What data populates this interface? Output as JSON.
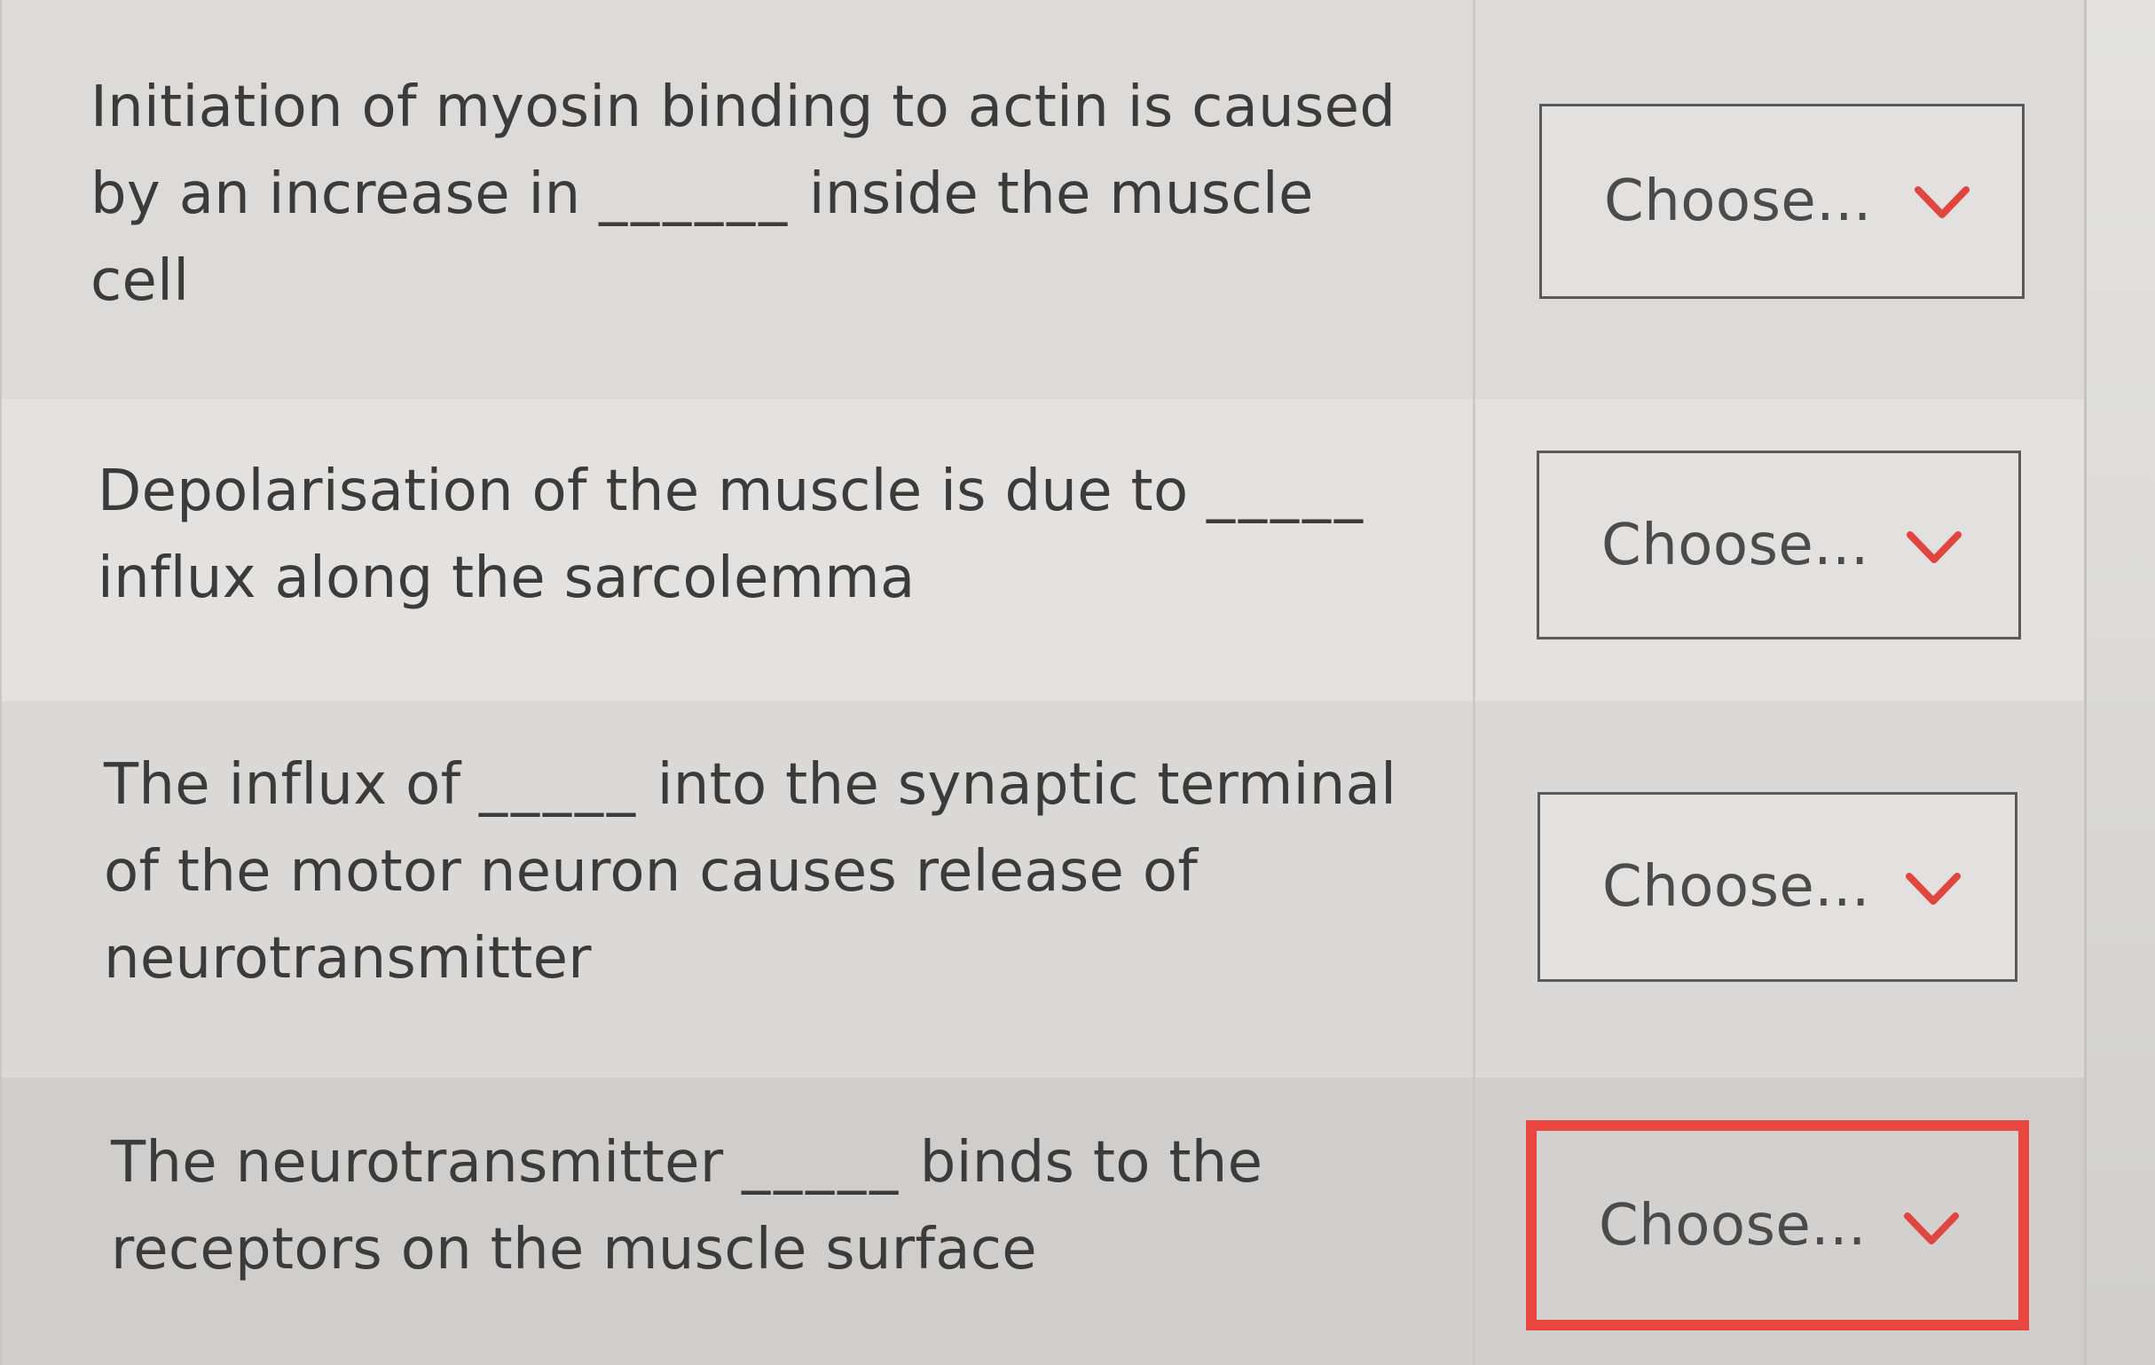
{
  "questions": [
    {
      "line1": "Initiation of myosin binding to actin is caused",
      "line2_before": "by an increase in ",
      "blank": "______",
      "line2_after": " inside the muscle",
      "line3": "cell",
      "select_label": "Choose..."
    },
    {
      "line1_before": "Depolarisation of the muscle is due to ",
      "blank": "_____",
      "line2": "influx along the sarcolemma",
      "select_label": "Choose..."
    },
    {
      "line1_before": "The influx of ",
      "blank": "_____",
      "line1_after": " into the synaptic terminal",
      "line2": "of the motor neuron causes release of",
      "line3": "neurotransmitter",
      "select_label": "Choose..."
    },
    {
      "line1_before": "The neurotransmitter ",
      "blank": "_____",
      "line1_after": " binds to the",
      "line2": "receptors on the muscle surface",
      "select_label": "Choose..."
    }
  ],
  "colors": {
    "chevron": "#e0463f",
    "focused_border": "#e8463e",
    "text": "#3b3b3b"
  },
  "icons": {
    "dropdown": "chevron-down-icon"
  }
}
